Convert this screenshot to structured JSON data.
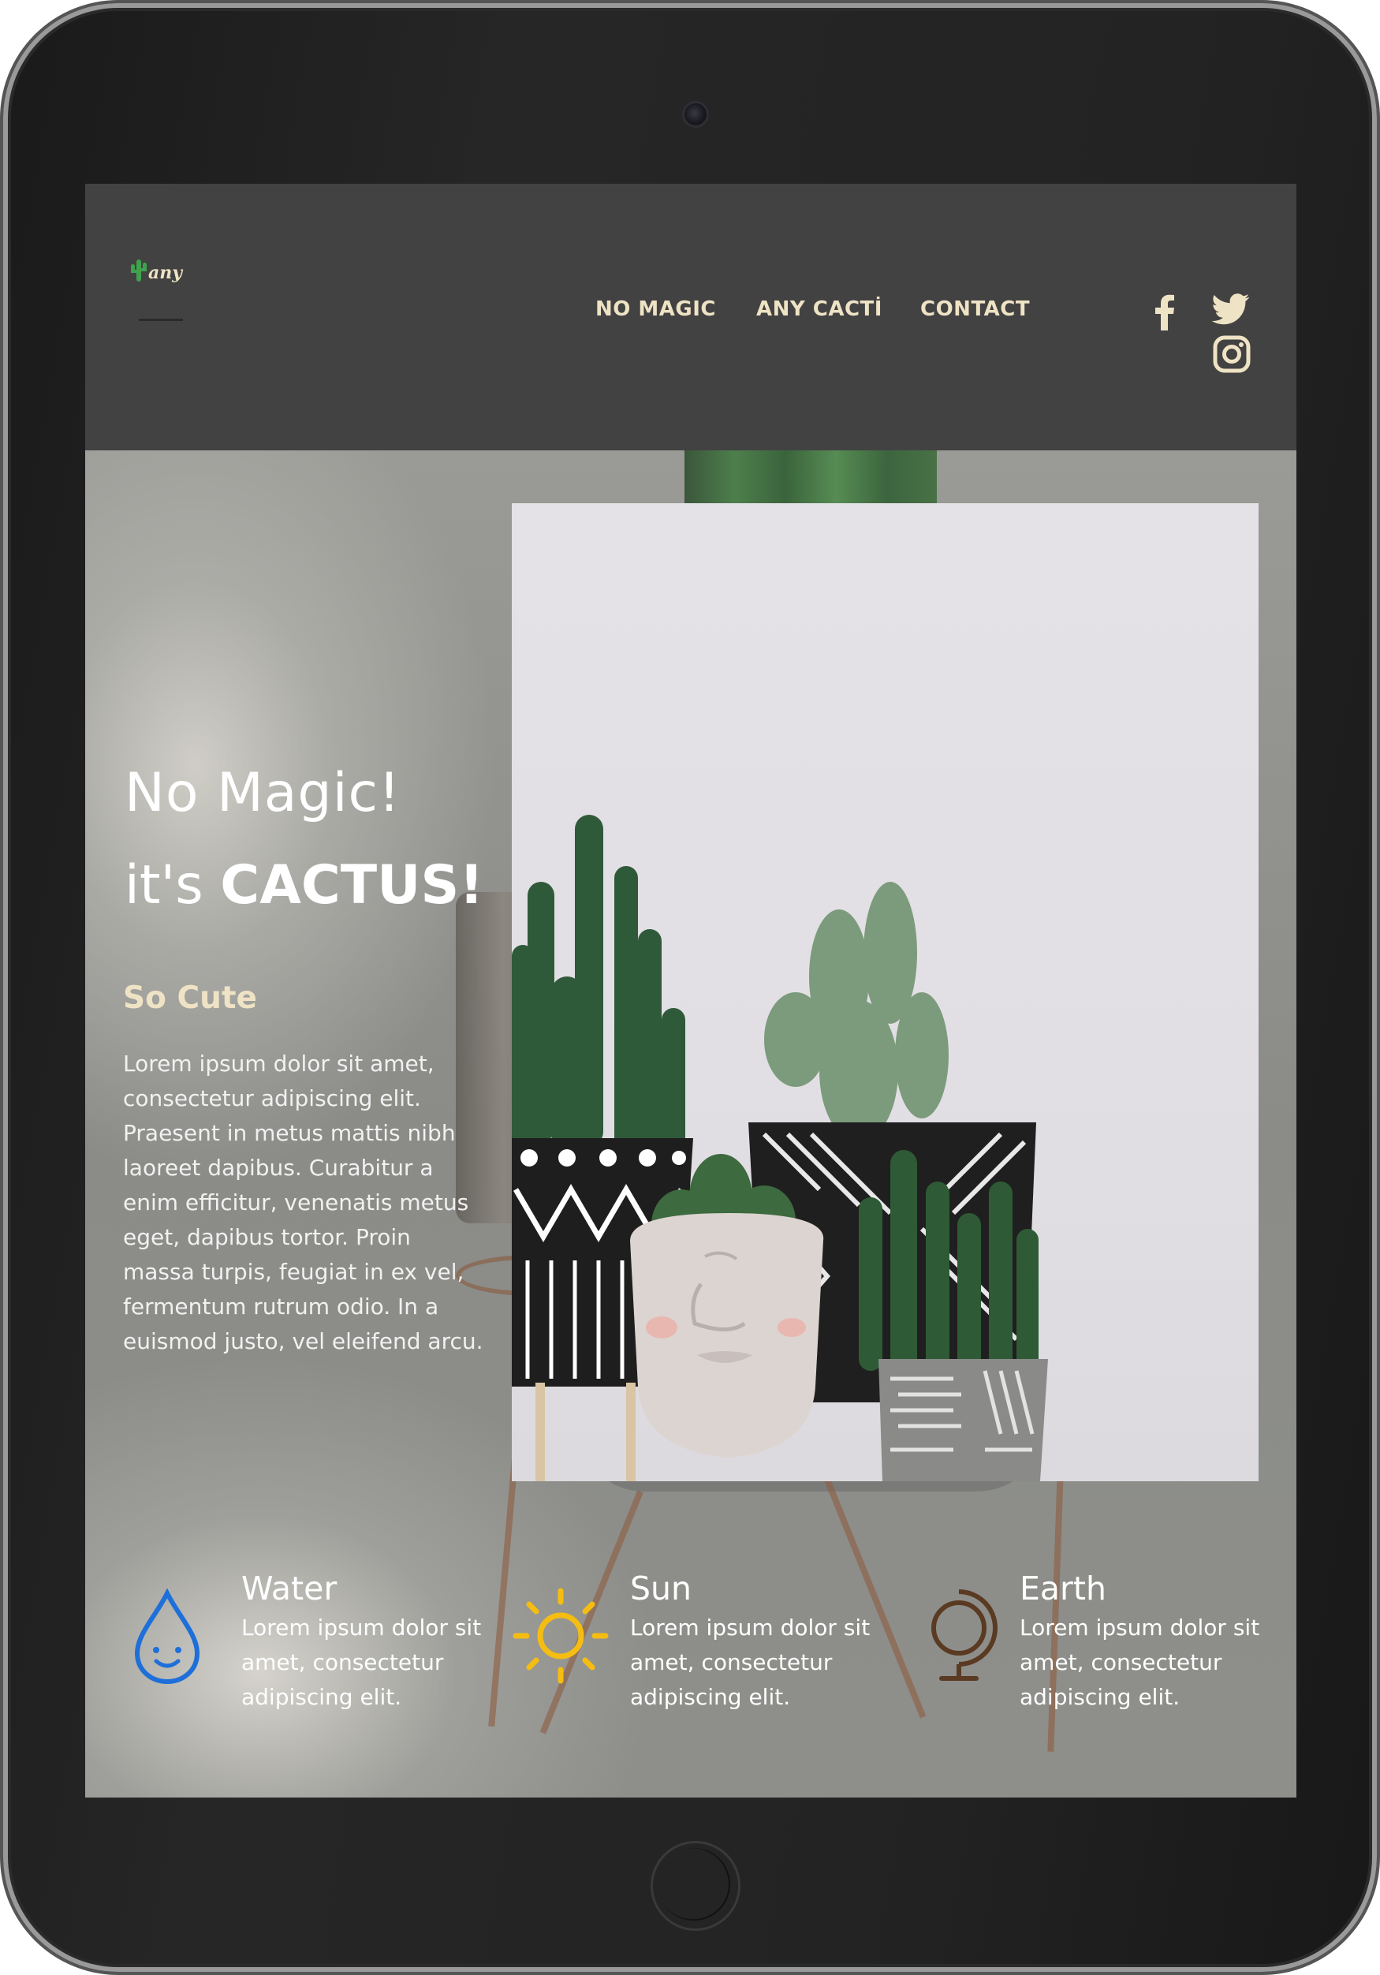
{
  "brand": {
    "logo_text": "any"
  },
  "nav": {
    "items": [
      {
        "label": "NO MAGIC"
      },
      {
        "label": "ANY CACTİ"
      },
      {
        "label": "CONTACT"
      }
    ]
  },
  "social": {
    "icons": [
      "facebook-icon",
      "twitter-icon",
      "instagram-icon"
    ]
  },
  "hero": {
    "headline_line1": "No Magic!",
    "headline_line2_prefix": "it's ",
    "headline_line2_bold": "CACTUS!",
    "subtitle": "So Cute",
    "body": "Lorem ipsum dolor sit amet, consectetur adipiscing elit. Praesent in metus mattis nibh laoreet dapibus. Curabitur a enim efficitur, venenatis metus eget, dapibus tortor. Proin massa turpis, feugiat in ex vel, fermentum rutrum odio. In a euismod justo, vel eleifend arcu."
  },
  "features": [
    {
      "title": "Water",
      "text": "Lorem ipsum dolor sit amet, consectetur adipiscing elit.",
      "icon": "water-drop-icon",
      "color": "#1e6fd9"
    },
    {
      "title": "Sun",
      "text": "Lorem ipsum dolor sit amet, consectetur adipiscing elit.",
      "icon": "sun-icon",
      "color": "#f5bd12"
    },
    {
      "title": "Earth",
      "text": "Lorem ipsum dolor sit amet, consectetur adipiscing elit.",
      "icon": "globe-icon",
      "color": "#5a3a22"
    }
  ],
  "colors": {
    "header_bg": "#424242",
    "nav_text": "#efe3c5",
    "accent_green": "#3fa34d"
  }
}
